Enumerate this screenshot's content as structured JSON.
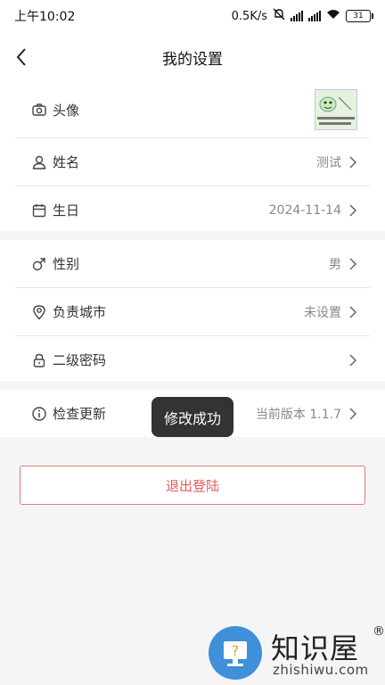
{
  "status": {
    "time": "上午10:02",
    "speed": "0.5K/s",
    "battery": "31"
  },
  "nav": {
    "title": "我的设置"
  },
  "profile": {
    "avatar_label": "头像",
    "name_label": "姓名",
    "name_value": "测试",
    "birthday_label": "生日",
    "birthday_value": "2024-11-14"
  },
  "details": {
    "gender_label": "性别",
    "gender_value": "男",
    "city_label": "负责城市",
    "city_value": "未设置",
    "password_label": "二级密码"
  },
  "update": {
    "label": "检查更新",
    "version": "当前版本 1.1.7"
  },
  "toast": "修改成功",
  "logout_label": "退出登陆",
  "watermark": {
    "title": "知识屋",
    "site": "zhishiwu.com",
    "reg": "®"
  }
}
